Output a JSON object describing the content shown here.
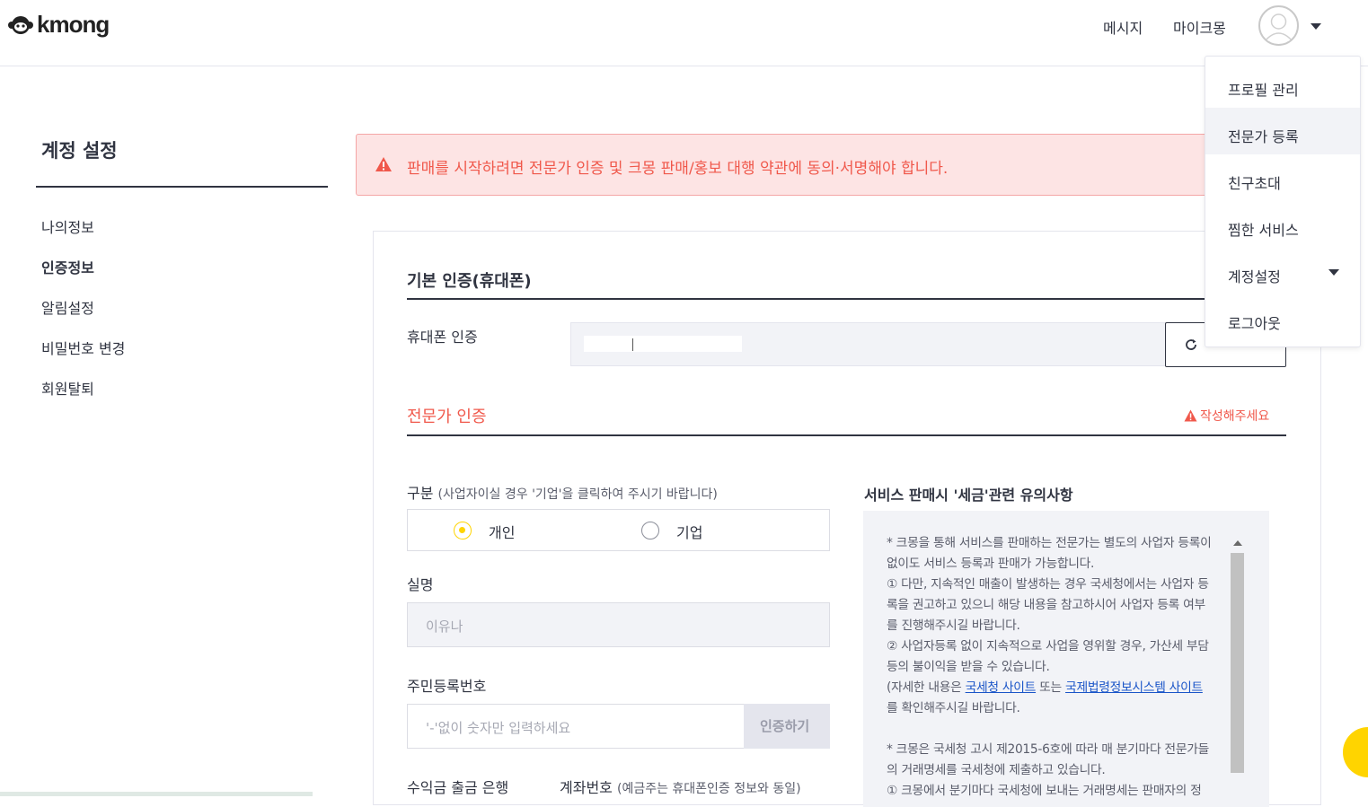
{
  "header": {
    "logo_text": "kmong",
    "nav": {
      "messages": "메시지",
      "mykmong": "마이크몽"
    }
  },
  "sidebar": {
    "title": "계정 설정",
    "items": [
      {
        "label": "나의정보"
      },
      {
        "label": "인증정보"
      },
      {
        "label": "알림설정"
      },
      {
        "label": "비밀번호 변경"
      },
      {
        "label": "회원탈퇴"
      }
    ]
  },
  "alert": {
    "text": "판매를 시작하려면 전문가 인증 및 크몽 판매/홍보 대행 약관에 동의·서명해야 합니다."
  },
  "basic_auth": {
    "title": "기본 인증(휴대폰)",
    "phone_label": "휴대폰 인증"
  },
  "expert_auth": {
    "title": "전문가 인증",
    "warning": "작성해주세요",
    "type_label": "구분",
    "type_hint": "(사업자이실 경우 '기업'을 클릭하여 주시기 바랍니다)",
    "options": [
      {
        "label": "개인",
        "selected": true
      },
      {
        "label": "기업",
        "selected": false
      }
    ],
    "name_label": "실명",
    "name_value": "이유나",
    "rrn_label": "주민등록번호",
    "rrn_placeholder": "'-'없이 숫자만 입력하세요",
    "verify_button": "인증하기",
    "bank_label": "수익금 출금 은행",
    "account_label": "계좌번호",
    "account_hint": "(예금주는 휴대폰인증 정보와 동일)"
  },
  "tax_notice": {
    "title": "서비스 판매시 '세금'관련 유의사항",
    "lines": [
      "* 크몽을 통해 서비스를 판매하는 전문가는 별도의 사업자 등록이",
      "없이도 서비스 등록과 판매가 가능합니다.",
      "① 다만, 지속적인 매출이 발생하는 경우 국세청에서는 사업자 등",
      "록을 권고하고 있으니 해당 내용을 참고하시어 사업자 등록 여부",
      "를 진행해주시길 바랍니다.",
      "② 사업자등록 없이 지속적으로 사업을 영위할 경우, 가산세 부담",
      "등의 불이익을 받을 수 있습니다."
    ],
    "detail_prefix": "(자세한 내용은 ",
    "link1": "국세청 사이트",
    "detail_mid": " 또는 ",
    "link2": "국제법령정보시스템 사이트",
    "detail_suffix": "를 확인해주시길 바랍니다.",
    "lines2": [
      "* 크몽은 국세청 고시 제2015-6호에 따라 매 분기마다 전문가들",
      "의 거래명세를 국세청에 제출하고 있습니다.",
      "① 크몽에서 분기마다 국세청에 보내는 거래명세는 판매자의 정"
    ]
  },
  "dropdown": {
    "items": [
      {
        "label": "프로필 관리"
      },
      {
        "label": "전문가 등록"
      },
      {
        "label": "친구초대"
      },
      {
        "label": "찜한 서비스"
      },
      {
        "label": "계정설정"
      },
      {
        "label": "로그아웃"
      }
    ]
  },
  "colors": {
    "accent": "#ffd400",
    "alert": "#f0584b",
    "alert_bg": "#fde4e4",
    "link": "#1a55c8"
  }
}
